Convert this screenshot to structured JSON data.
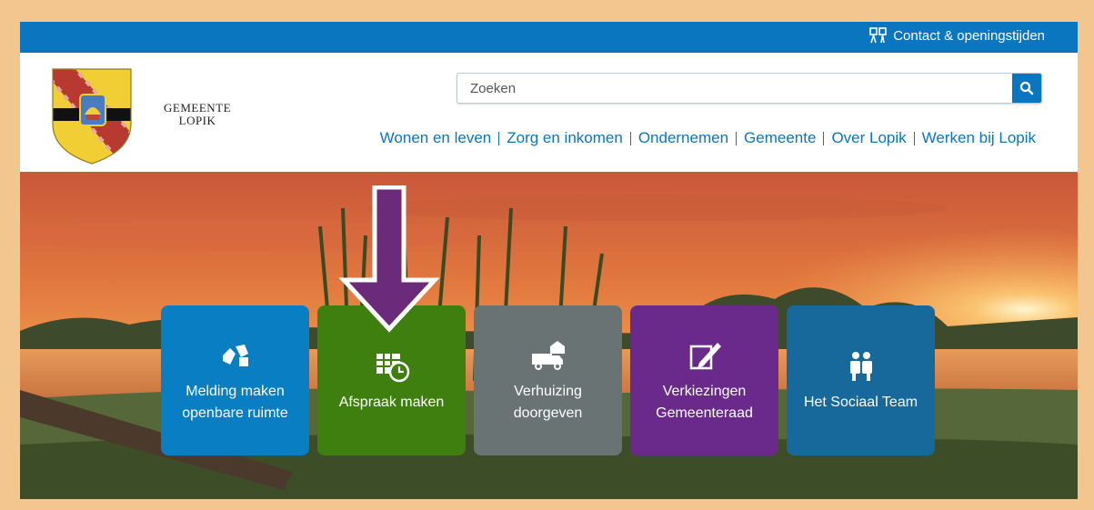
{
  "topbar": {
    "contact_label": "Contact & openingstijden",
    "icon": "people-icon",
    "color": "#0a76bf"
  },
  "logo": {
    "line1": "GEMEENTE",
    "line2": "LOPIK"
  },
  "search": {
    "placeholder": "Zoeken",
    "value": "",
    "icon": "search-icon"
  },
  "nav": {
    "items": [
      {
        "label": "Wonen en leven"
      },
      {
        "label": "Zorg en inkomen"
      },
      {
        "label": "Ondernemen"
      },
      {
        "label": "Gemeente"
      },
      {
        "label": "Over Lopik"
      },
      {
        "label": "Werken bij Lopik"
      }
    ]
  },
  "tiles": [
    {
      "label": "Melding maken openbare ruimte",
      "color": "#0a7ec2",
      "icon": "report-icon"
    },
    {
      "label": "Afspraak maken",
      "color": "#3f7f10",
      "icon": "calendar-clock-icon"
    },
    {
      "label": "Verhuizing doorgeven",
      "color": "#6a7373",
      "icon": "moving-truck-icon"
    },
    {
      "label": "Verkiezingen Gemeenteraad",
      "color": "#6a2a8c",
      "icon": "ballot-pencil-icon"
    },
    {
      "label": "Het Sociaal Team",
      "color": "#16699a",
      "icon": "team-icon"
    }
  ],
  "annotation": {
    "icon": "down-arrow-icon",
    "color": "#6b2a7a"
  }
}
